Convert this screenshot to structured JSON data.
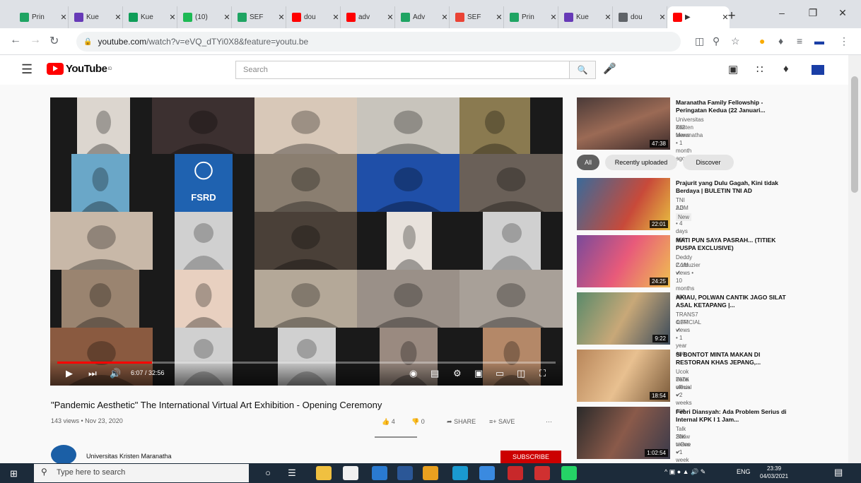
{
  "browser": {
    "tabs": [
      {
        "label": "Prin",
        "color": "#1fa463"
      },
      {
        "label": "Kue",
        "color": "#673ab7"
      },
      {
        "label": "Kue",
        "color": "#0f9d58"
      },
      {
        "label": "(10)",
        "color": "#1db954"
      },
      {
        "label": "SEF",
        "color": "#1fa463"
      },
      {
        "label": "dou",
        "color": "#ff0000"
      },
      {
        "label": "adv",
        "color": "#ff0000"
      },
      {
        "label": "Adv",
        "color": "#1fa463"
      },
      {
        "label": "SEF",
        "color": "#ea4335"
      },
      {
        "label": "Prin",
        "color": "#1fa463"
      },
      {
        "label": "Kue",
        "color": "#673ab7"
      },
      {
        "label": "dou",
        "color": "#5f6368"
      },
      {
        "label": "▶",
        "color": "#ff0000"
      }
    ],
    "new_tab": "+",
    "window_controls": [
      "–",
      "❐",
      "✕"
    ],
    "url_host": "youtube.com",
    "url_path": "/watch?v=eVQ_dTYi0X8&feature=youtu.be"
  },
  "youtube": {
    "logo_text": "YouTube",
    "logo_sup": "ID",
    "search_placeholder": "Search",
    "video": {
      "time": "6:07 / 32:56",
      "progress": 0.19,
      "title": "\"Pandemic Aesthetic\" The International Virtual Art Exhibition - Opening Ceremony",
      "meta": "143 views • Nov 23, 2020",
      "likes": "4",
      "dislikes": "0",
      "share": "SHARE",
      "save": "SAVE",
      "channel": "Universitas Kristen Maranatha",
      "subscribe": "SUBSCRIBE",
      "fsrd_label": "FSRD"
    },
    "chips": [
      "All",
      "Recently uploaded",
      "Discover"
    ],
    "top_rec": {
      "title": "Maranatha Family Fellowship - Peringatan Kedua (22 Januari...",
      "channel": "Universitas Kristen Maranatha",
      "meta": "262 views • 1 month ago",
      "duration": "47:38"
    },
    "recommendations": [
      {
        "title": "Prajurit yang Dulu Gagah, Kini tidak Berdaya | BULETIN TNI AD",
        "channel": "TNI AD",
        "meta": "2.3M views • 4 days ago",
        "badge": "New",
        "duration": "22:01"
      },
      {
        "title": "MATI PUN SAYA PASRAH... (TITIEK PUSPA EXCLUSIVE)",
        "channel": "Deddy Corbuzier",
        "meta": "2.1M views • 10 months ago",
        "badge": "",
        "duration": "24:25"
      },
      {
        "title": "AKIAU, POLWAN CANTIK JAGO SILAT ASAL KETAPANG |...",
        "channel": "TRANS7 OFFICIAL",
        "meta": "4.3M views • 1 year ago",
        "badge": "",
        "duration": "9:22"
      },
      {
        "title": "SI BONTOT MINTA MAKAN DI RESTORAN KHAS JEPANG,...",
        "channel": "Ucok Baba official",
        "meta": "767K views • 2 weeks ago",
        "badge": "",
        "duration": "18:54"
      },
      {
        "title": "Febri Diansyah: Ada Problem Serius di Internal KPK I 1 Jam...",
        "channel": "Talk Show tvOne",
        "meta": "20K views • 1 week ago",
        "badge": "",
        "duration": "1:02:54"
      }
    ]
  },
  "taskbar": {
    "search_placeholder": "Type here to search",
    "lang": "ENG",
    "time": "23:39",
    "date": "04/03/2021"
  }
}
